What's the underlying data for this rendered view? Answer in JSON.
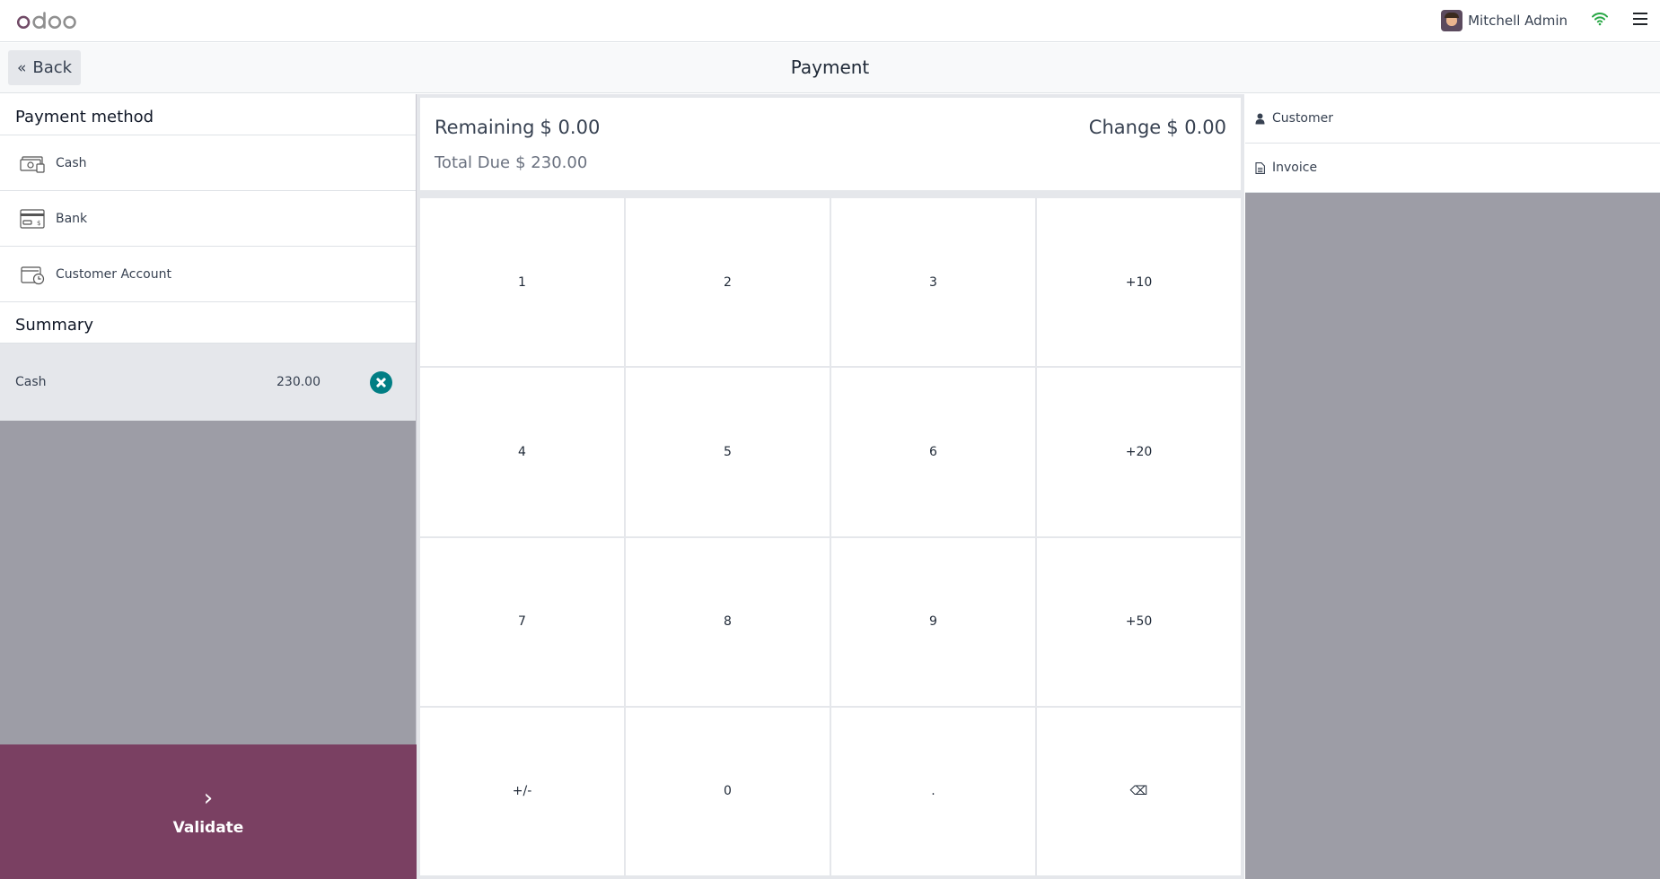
{
  "navbar": {
    "logo": "odoo",
    "user_name": "Mitchell Admin"
  },
  "controlbar": {
    "back_label": "Back",
    "title": "Payment"
  },
  "payment_methods": {
    "title": "Payment method",
    "items": [
      {
        "label": "Cash",
        "icon": "cash-icon"
      },
      {
        "label": "Bank",
        "icon": "card-icon"
      },
      {
        "label": "Customer Account",
        "icon": "wallet-clock-icon"
      }
    ]
  },
  "summary": {
    "title": "Summary",
    "lines": [
      {
        "method": "Cash",
        "amount": "230.00"
      }
    ]
  },
  "validate_label": "Validate",
  "status": {
    "remaining_label": "Remaining",
    "remaining_value": "$ 0.00",
    "change_label": "Change",
    "change_value": "$ 0.00",
    "total_due_label": "Total Due",
    "total_due_value": "$ 230.00"
  },
  "numpad": [
    "1",
    "2",
    "3",
    "+10",
    "4",
    "5",
    "6",
    "+20",
    "7",
    "8",
    "9",
    "+50",
    "+/-",
    "0",
    ".",
    "⌫"
  ],
  "right_panel": {
    "customer_label": "Customer",
    "invoice_label": "Invoice"
  },
  "colors": {
    "validate_bg": "#7a4062",
    "remove_btn": "#017e84",
    "wifi": "#28a745"
  }
}
